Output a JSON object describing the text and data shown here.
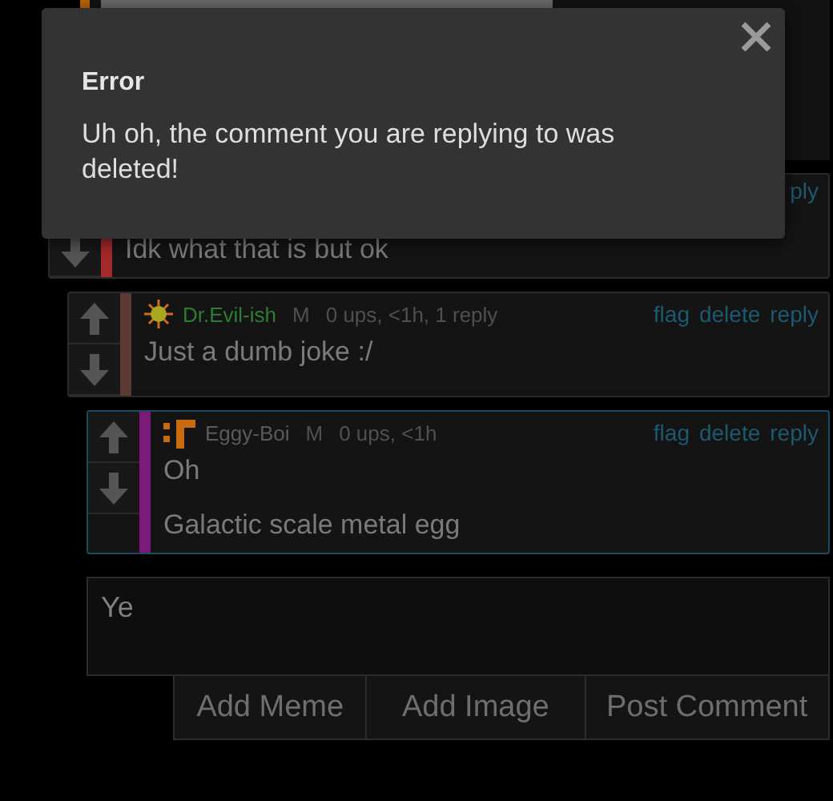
{
  "comments": [
    {
      "color": "#a52a2a",
      "highlighted": false,
      "actions": [
        "ply"
      ],
      "paragraphs": [
        "Idk what that is but ok"
      ],
      "children": [
        {
          "avatar": {
            "kind": "sun"
          },
          "author": {
            "name": "Dr.Evil-ish",
            "color": "#2e7d32"
          },
          "badge": "M",
          "meta": "0 ups, <1h, 1 reply",
          "actions": [
            "flag",
            "delete",
            "reply"
          ],
          "color": "#5a3a32",
          "highlighted": false,
          "paragraphs": [
            "Just a dumb joke :/"
          ],
          "children": [
            {
              "avatar": {
                "kind": "blocks"
              },
              "author": {
                "name": "Eggy-Boi",
                "color": "#5a5a5a"
              },
              "badge": "M",
              "meta": "0 ups, <1h",
              "actions": [
                "flag",
                "delete",
                "reply"
              ],
              "color": "#7b1a7b",
              "highlighted": true,
              "paragraphs": [
                "Oh",
                "Galactic scale metal egg"
              ]
            }
          ]
        }
      ]
    }
  ],
  "reply_form": {
    "value": "Ye",
    "buttons": [
      "Add Meme",
      "Add Image",
      "Post Comment"
    ]
  },
  "modal": {
    "title": "Error",
    "message": "Uh oh, the comment you are replying to was deleted!"
  }
}
